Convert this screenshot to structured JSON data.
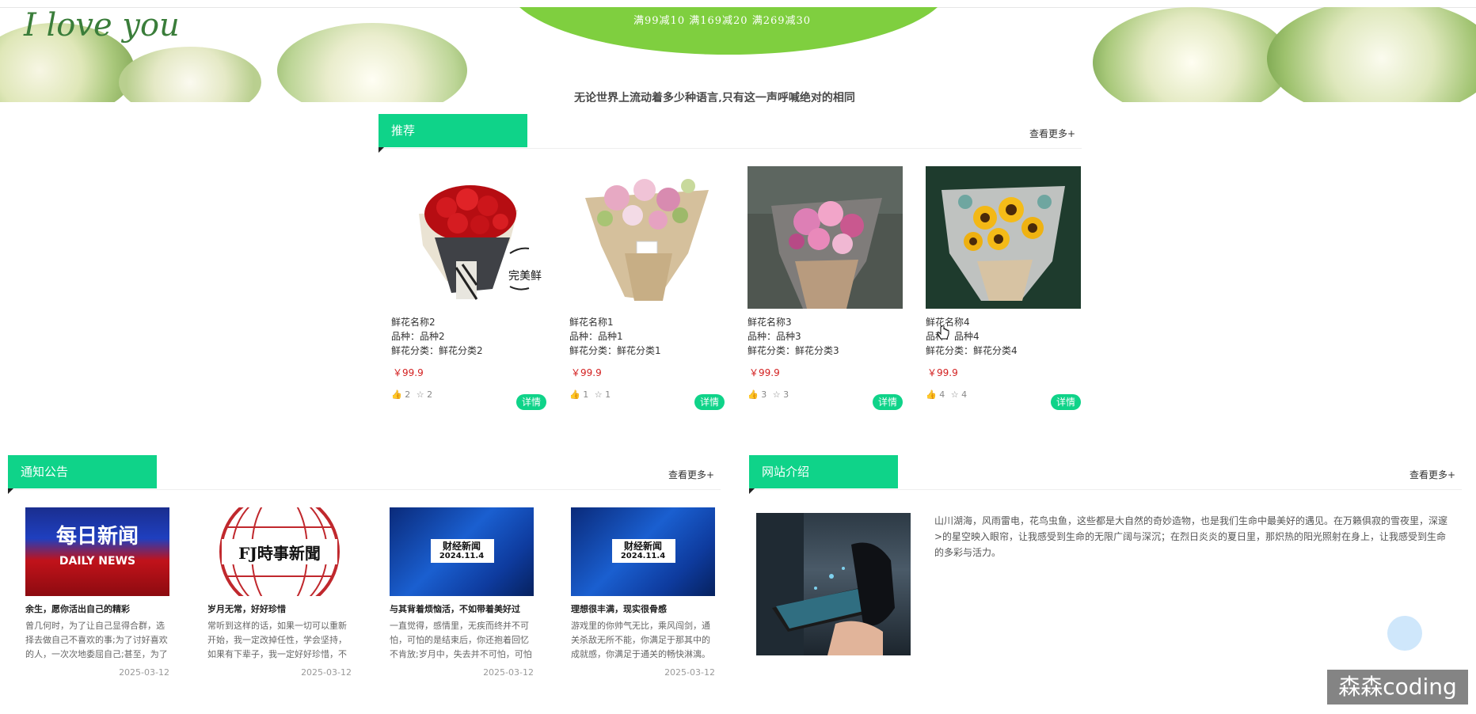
{
  "banner": {
    "script_text": "I love you",
    "arc_text": "满99减10 满169减20 满269减30",
    "slogan": "无论世界上流动着多少种语言,只有这一声呼喊绝对的相同"
  },
  "recommend": {
    "title": "推荐",
    "more": "查看更多+",
    "items": [
      {
        "name": "鲜花名称2",
        "variety": "品种：品种2",
        "category": "鲜花分类：鲜花分类2",
        "price": "￥99.9",
        "likes": "2",
        "favs": "2",
        "detail": "详情",
        "overlay_text": "完美鲜",
        "image": "red-roses-bouquet"
      },
      {
        "name": "鲜花名称1",
        "variety": "品种：品种1",
        "category": "鲜花分类：鲜花分类1",
        "price": "￥99.9",
        "likes": "1",
        "favs": "1",
        "detail": "详情",
        "image": "pink-mixed-bouquet"
      },
      {
        "name": "鲜花名称3",
        "variety": "品种：品种3",
        "category": "鲜花分类：鲜花分类3",
        "price": "￥99.9",
        "likes": "3",
        "favs": "3",
        "detail": "详情",
        "image": "pink-flowers-bouquet"
      },
      {
        "name": "鲜花名称4",
        "variety": "品种：品种4",
        "category": "鲜花分类：鲜花分类4",
        "price": "￥99.9",
        "likes": "4",
        "favs": "4",
        "detail": "详情",
        "image": "sunflower-bouquet"
      }
    ]
  },
  "notice": {
    "title": "通知公告",
    "more": "查看更多+",
    "items": [
      {
        "title": "余生，愿你活出自己的精彩",
        "desc": "曾几何时，为了让自己显得合群，选择去做自己不喜欢的事;为了讨好喜欢的人，一次次地委屈自己;甚至，为了陌生",
        "date": "2025-03-12",
        "img_text_1": "每日新闻",
        "img_text_2": "DAILY NEWS"
      },
      {
        "title": "岁月无常，好好珍惜",
        "desc": "常听到这样的话，如果一切可以重新开始，我一定改掉任性，学会坚持，如果有下辈子，我一定好好珍惜，不会再弄",
        "date": "2025-03-12",
        "img_text_1": "FJ時事新聞"
      },
      {
        "title": "与其背着烦恼活，不如带着美好过",
        "desc": "一直觉得，感情里，无疾而终并不可怕，可怕的是结束后，你还抱着回忆不肯放;岁月中，失去并不可怕，可怕的是",
        "date": "2025-03-12",
        "img_text_1": "财经新闻",
        "img_text_2": "2024.11.4"
      },
      {
        "title": "理想很丰满，现实很骨感",
        "desc": "游戏里的你帅气无比，乘风闯剑，通关杀敌无所不能，你满足于那其中的成就感，你满足于通关的畅快淋漓。",
        "date": "2025-03-12",
        "img_text_1": "财经新闻",
        "img_text_2": "2024.11.4"
      }
    ]
  },
  "about": {
    "title": "网站介绍",
    "more": "查看更多+",
    "text": "山川湖海，风雨雷电，花鸟虫鱼，这些都是大自然的奇妙造物，也是我们生命中最美好的遇见。在万籁俱寂的雪夜里，深邃>的星空映入眼帘，让我感受到生命的无限广阔与深沉；在烈日炎炎的夏日里，那炽热的阳光照射在身上，让我感受到生命的多彩与活力。"
  },
  "watermark": "森森coding",
  "colors": {
    "accent": "#0fd389",
    "price": "#d32020"
  }
}
